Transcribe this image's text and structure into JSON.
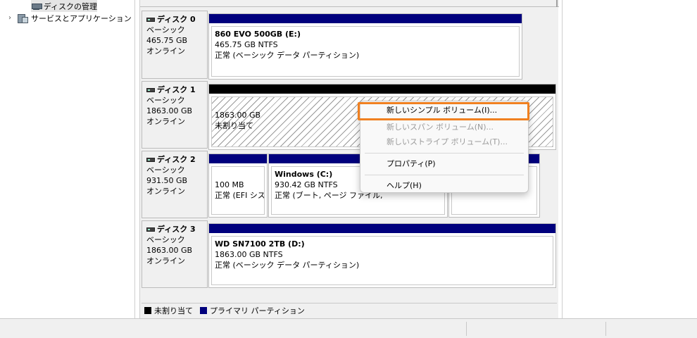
{
  "tree": {
    "disk_management": "ディスクの管理",
    "services_and_apps": "サービスとアプリケーション",
    "expand_glyph": "›"
  },
  "disks": [
    {
      "name": "ディスク 0",
      "type": "ベーシック",
      "size": "465.75 GB",
      "status": "オンライン",
      "partitions": [
        {
          "label": "860 EVO 500GB  (E:)",
          "size": "465.75 GB NTFS",
          "status": "正常 (ベーシック データ パーティション)"
        }
      ]
    },
    {
      "name": "ディスク 1",
      "type": "ベーシック",
      "size": "1863.00 GB",
      "status": "オンライン",
      "partitions": [
        {
          "label": "",
          "size": "1863.00 GB",
          "status": "未割り当て"
        }
      ]
    },
    {
      "name": "ディスク 2",
      "type": "ベーシック",
      "size": "931.50 GB",
      "status": "オンライン",
      "partitions": [
        {
          "label": "",
          "size": "100 MB",
          "status": "正常 (EFI シス"
        },
        {
          "label": "Windows  (C:)",
          "size": "930.42 GB NTFS",
          "status": "正常 (ブート, ページ ファイル,"
        },
        {
          "label": "",
          "size": "",
          "status": ""
        }
      ]
    },
    {
      "name": "ディスク 3",
      "type": "ベーシック",
      "size": "1863.00 GB",
      "status": "オンライン",
      "partitions": [
        {
          "label": "WD SN7100 2TB  (D:)",
          "size": "1863.00 GB NTFS",
          "status": "正常 (ベーシック データ パーティション)"
        }
      ]
    }
  ],
  "legend": {
    "unallocated": "未割り当て",
    "primary": "プライマリ パーティション",
    "unallocated_color": "#000000",
    "primary_color": "#00007d"
  },
  "context_menu": {
    "items": [
      {
        "label": "新しいシンプル ボリューム(I)...",
        "enabled": true
      },
      {
        "label": "新しいスパン ボリューム(N)...",
        "enabled": false
      },
      {
        "label": "新しいストライプ ボリューム(T)...",
        "enabled": false
      },
      {
        "label": "プロパティ(P)",
        "enabled": true
      },
      {
        "label": "ヘルプ(H)",
        "enabled": true
      }
    ],
    "highlight_color": "#f08020"
  },
  "colors": {
    "partition_bar": "#00007d",
    "unallocated_bar": "#000000"
  }
}
